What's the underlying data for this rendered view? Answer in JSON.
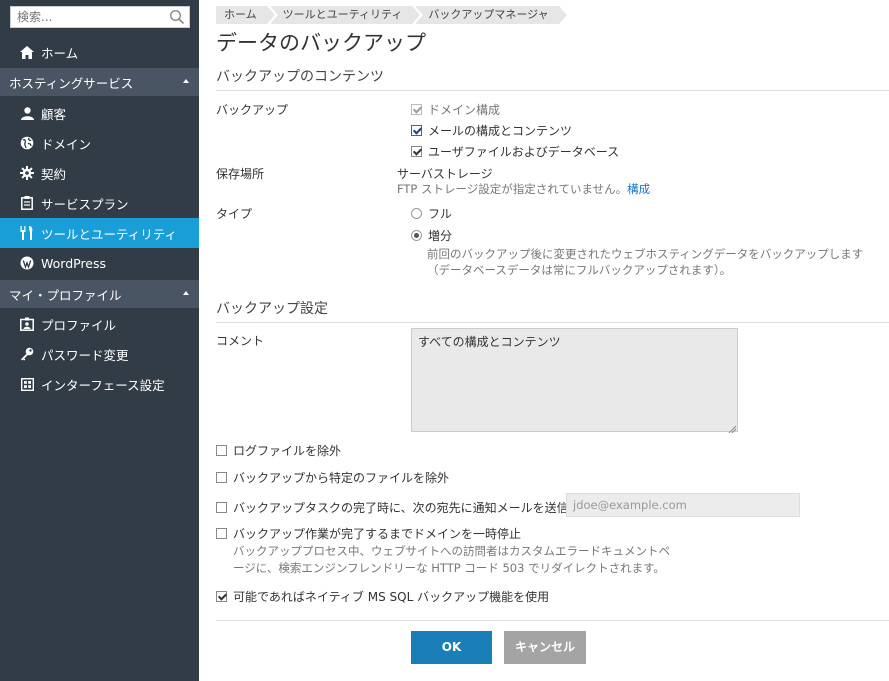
{
  "sidebar": {
    "search_placeholder": "検索...",
    "home": "ホーム",
    "group_hosting": "ホスティングサービス",
    "items_hosting": [
      "顧客",
      "ドメイン",
      "契約",
      "サービスプラン",
      "ツールとユーティリティ",
      "WordPress"
    ],
    "group_profile": "マイ・プロファイル",
    "items_profile": [
      "プロファイル",
      "パスワード変更",
      "インターフェース設定"
    ],
    "active_item": "ツールとユーティリティ",
    "active_color": "#199ed8"
  },
  "breadcrumb": [
    "ホーム",
    "ツールとユーティリティ",
    "バックアップマネージャ"
  ],
  "page_title": "データのバックアップ",
  "contents_section": {
    "title": "バックアップのコンテンツ",
    "backup_label": "バックアップ",
    "backup_options": [
      {
        "label": "ドメイン構成",
        "checked": true,
        "disabled": true
      },
      {
        "label": "メールの構成とコンテンツ",
        "checked": true,
        "disabled": false
      },
      {
        "label": "ユーザファイルおよびデータベース",
        "checked": true,
        "disabled": false
      }
    ],
    "storage_label": "保存場所",
    "storage_value": "サーバストレージ",
    "storage_note": "FTP ストレージ設定が指定されていません。",
    "storage_link": "構成",
    "type_label": "タイプ",
    "type_options": [
      {
        "label": "フル",
        "checked": false
      },
      {
        "label": "増分",
        "checked": true
      }
    ],
    "incremental_note_1": "前回のバックアップ後に変更されたウェブホスティングデータをバックアップします",
    "incremental_note_2": "（データベースデータは常にフルバックアップされます）。"
  },
  "settings_section": {
    "title": "バックアップ設定",
    "comment_label": "コメント",
    "comment_value": "すべての構成とコンテンツ",
    "options": [
      {
        "label": "ログファイルを除外",
        "checked": false
      },
      {
        "label": "バックアップから特定のファイルを除外",
        "checked": false
      },
      {
        "label": "バックアップタスクの完了時に、次の宛先に通知メールを送信",
        "checked": false
      },
      {
        "label": "バックアップ作業が完了するまでドメインを一時停止",
        "checked": false
      },
      {
        "label": "可能であればネイティブ MS SQL バックアップ機能を使用",
        "checked": true
      }
    ],
    "email_placeholder": "jdoe@example.com",
    "suspend_note_1": "バックアッププロセス中、ウェブサイトへの訪問者はカスタムエラードキュメントペ",
    "suspend_note_2": "ージに、検索エンジンフレンドリーな HTTP コード 503 でリダイレクトされます。"
  },
  "buttons": {
    "ok": "OK",
    "cancel": "キャンセル",
    "ok_color": "#1a7fb9",
    "cancel_color": "#a4a4a4"
  }
}
